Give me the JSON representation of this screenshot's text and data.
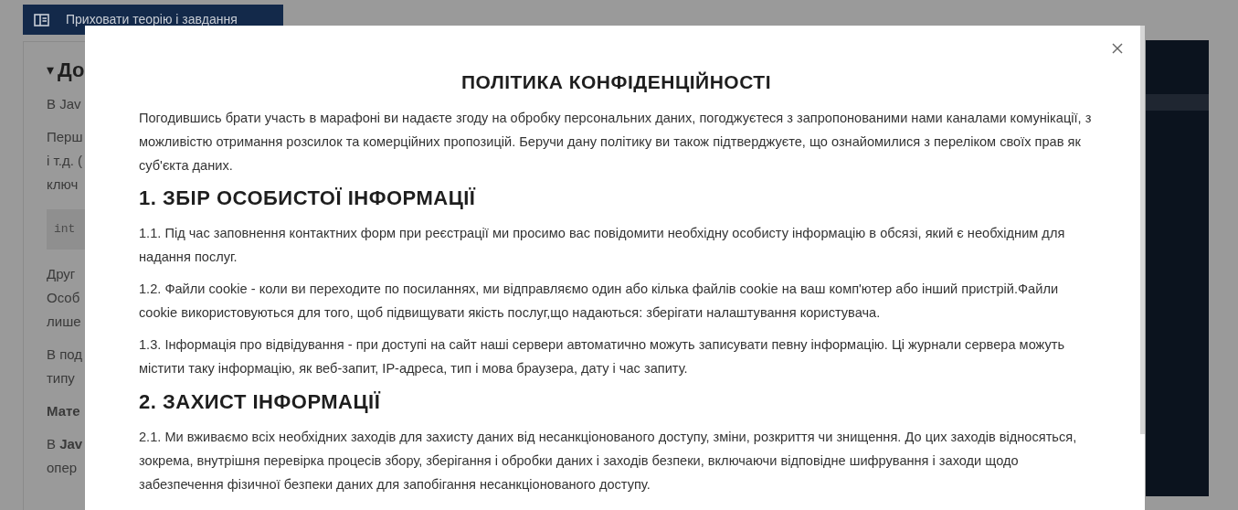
{
  "background": {
    "toggle_button": "Приховати теорію і завдання",
    "section": {
      "caret": "▾",
      "heading": "До",
      "blocks": [
        {
          "kind": "text",
          "lines": [
            "В Jav"
          ]
        },
        {
          "kind": "text",
          "lines": [
            "Перш",
            "і т.д. (",
            "ключ"
          ]
        },
        {
          "kind": "code",
          "lines": [
            "int"
          ]
        },
        {
          "kind": "text",
          "lines": [
            "Друг",
            "Особ",
            "лише"
          ]
        },
        {
          "kind": "text",
          "lines": [
            "В под",
            "типу"
          ]
        },
        {
          "kind": "bold",
          "lines": [
            "Мате"
          ]
        },
        {
          "kind": "text",
          "lines": [
            "В **Jav**",
            "опер"
          ]
        }
      ]
    }
  },
  "modal": {
    "title": "ПОЛІТИКА КОНФІДЕНЦІЙНОСТІ",
    "blocks": [
      {
        "kind": "intro",
        "text": "Погодившись брати участь в марафоні ви надаєте згоду на обробку персональних даних, погоджуєтеся з запропонованими нами каналами комунікації, з можливістю отримання розсилок та комерційних пропозицій. Беручи дану політику ви також підтверджуєте, що ознайомилися з переліком своїх прав як суб'єкта даних."
      },
      {
        "kind": "heading",
        "text": "1. ЗБІР ОСОБИСТОЇ ІНФОРМАЦІЇ"
      },
      {
        "kind": "paragraph",
        "text": "1.1. Під час заповнення контактних форм при реєстрації ми просимо вас повідомити необхідну особисту інформацію в обсязі, який є необхідним для надання послуг."
      },
      {
        "kind": "paragraph",
        "text": "1.2. Файли cookie - коли ви переходите по посиланнях, ми відправляємо один або кілька файлів cookie на ваш комп'ютер або інший пристрій.Файли cookie використовуються для того, щоб підвищувати якість послуг,що надаються: зберігати налаштування користувача."
      },
      {
        "kind": "paragraph",
        "text": "1.3. Інформація про відвідування - при доступі на сайт наші сервери автоматично можуть записувати певну інформацію. Ці журнали сервера можуть містити таку інформацію, як веб-запит, IP-адреса, тип і мова браузера, дату і час запиту."
      },
      {
        "kind": "heading",
        "text": "2. ЗАХИСТ ІНФОРМАЦІЇ"
      },
      {
        "kind": "paragraph",
        "text": "2.1. Ми вживаємо всіх необхідних заходів для захисту даних від несанкціонованого доступу, зміни, розкриття чи знищення. До цих заходів відносяться, зокрема, внутрішня перевірка процесів збору, зберігання і обробки даних і заходів безпеки, включаючи відповідне шифрування і заходи щодо забезпечення фізичної безпеки даних для запобігання несанкціонованого доступу."
      }
    ]
  }
}
